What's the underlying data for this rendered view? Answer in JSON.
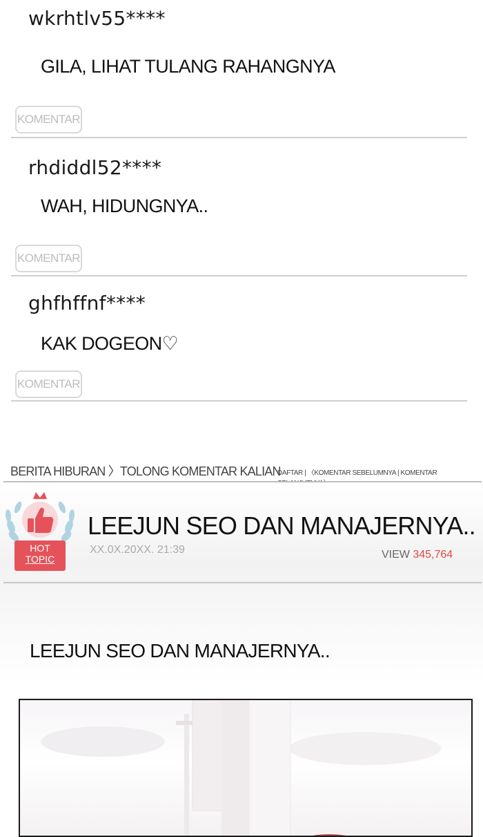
{
  "comments": [
    {
      "user": "wkrhtlv55****",
      "text": "GILA, LIHAT TULANG RAHANGNYA",
      "button": "KOMENTAR"
    },
    {
      "user": "rhdiddl52****",
      "text": "WAH, HIDUNGNYA..",
      "button": "KOMENTAR"
    },
    {
      "user": "ghfhffnf****",
      "text": "KAK DOGEON♡",
      "button": "KOMENTAR"
    }
  ],
  "breadcrumb": "BERITA HIBURAN 〉TOLONG KOMENTAR KALIAN",
  "nav_links": "DAFTAR | 〈KOMENTAR SEBELUMNYA | KOMENTAR SELANJUTNYA〉",
  "badge": {
    "line1": "HOT",
    "line2": "TOPIC",
    "color": "#e5525a"
  },
  "post": {
    "title": "LEEJUN SEO DAN MANAJERNYA..",
    "date": "XX.0X.20XX. 21:39",
    "view_label": "VIEW",
    "view_count": "345,764",
    "body_title": "LEEJUN SEO DAN MANAJERNYA.."
  },
  "colors": {
    "accent": "#e04848",
    "rule": "#cfcfcf",
    "button_border": "#d9d9d9"
  }
}
